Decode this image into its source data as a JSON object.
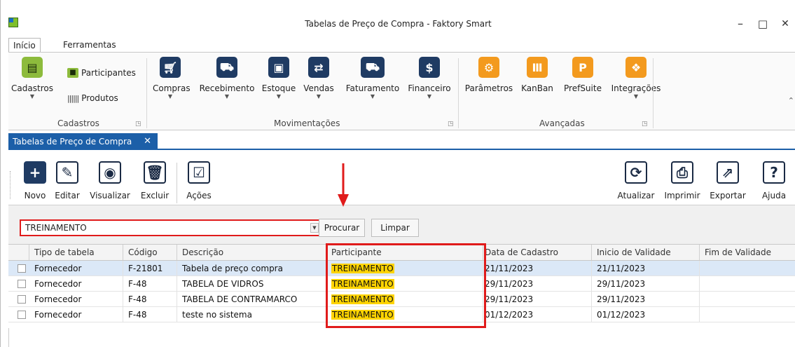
{
  "window": {
    "title": "Tabelas de Preço de Compra - Faktory Smart",
    "minimize": "–",
    "maximize": "□",
    "close": "✕"
  },
  "menu_tabs": [
    "Início",
    "Ferramentas"
  ],
  "ribbon": {
    "groups": [
      {
        "label": "Cadastros"
      },
      {
        "label": "Movimentações"
      },
      {
        "label": "Avançadas"
      }
    ],
    "cadastros": {
      "main": "Cadastros",
      "participantes": "Participantes",
      "produtos": "Produtos"
    },
    "movimentacoes": [
      "Compras",
      "Recebimento",
      "Estoque",
      "Vendas",
      "Faturamento",
      "Financeiro"
    ],
    "avancadas": [
      "Parâmetros",
      "KanBan",
      "PrefSuite",
      "Integrações"
    ]
  },
  "doc_tab": {
    "label": "Tabelas de Preço de Compra",
    "close": "✕"
  },
  "toolbar": {
    "left": [
      "Novo",
      "Editar",
      "Visualizar",
      "Excluir",
      "Ações"
    ],
    "right": [
      "Atualizar",
      "Imprimir",
      "Exportar",
      "Ajuda"
    ]
  },
  "filter": {
    "value": "TREINAMENTO",
    "search_button": "Procurar",
    "clear_button": "Limpar"
  },
  "grid": {
    "columns": [
      "Tipo de tabela",
      "Código",
      "Descrição",
      "Participante",
      "Data de Cadastro",
      "Inicio de Validade",
      "Fim de Validade"
    ],
    "rows": [
      [
        "Fornecedor",
        "F-21801",
        "Tabela de preço compra",
        "TREINAMENTO",
        "21/11/2023",
        "21/11/2023",
        ""
      ],
      [
        "Fornecedor",
        "F-48",
        "TABELA DE VIDROS",
        "TREINAMENTO",
        "29/11/2023",
        "29/11/2023",
        ""
      ],
      [
        "Fornecedor",
        "F-48",
        "TABELA DE CONTRAMARCO",
        "TREINAMENTO",
        "29/11/2023",
        "29/11/2023",
        ""
      ],
      [
        "Fornecedor",
        "F-48",
        "teste no sistema",
        "TREINAMENTO",
        "01/12/2023",
        "01/12/2023",
        ""
      ]
    ]
  },
  "colors": {
    "accent": "#1c5fa8",
    "highlight": "#ffd400",
    "annotation": "#e01b1b"
  }
}
